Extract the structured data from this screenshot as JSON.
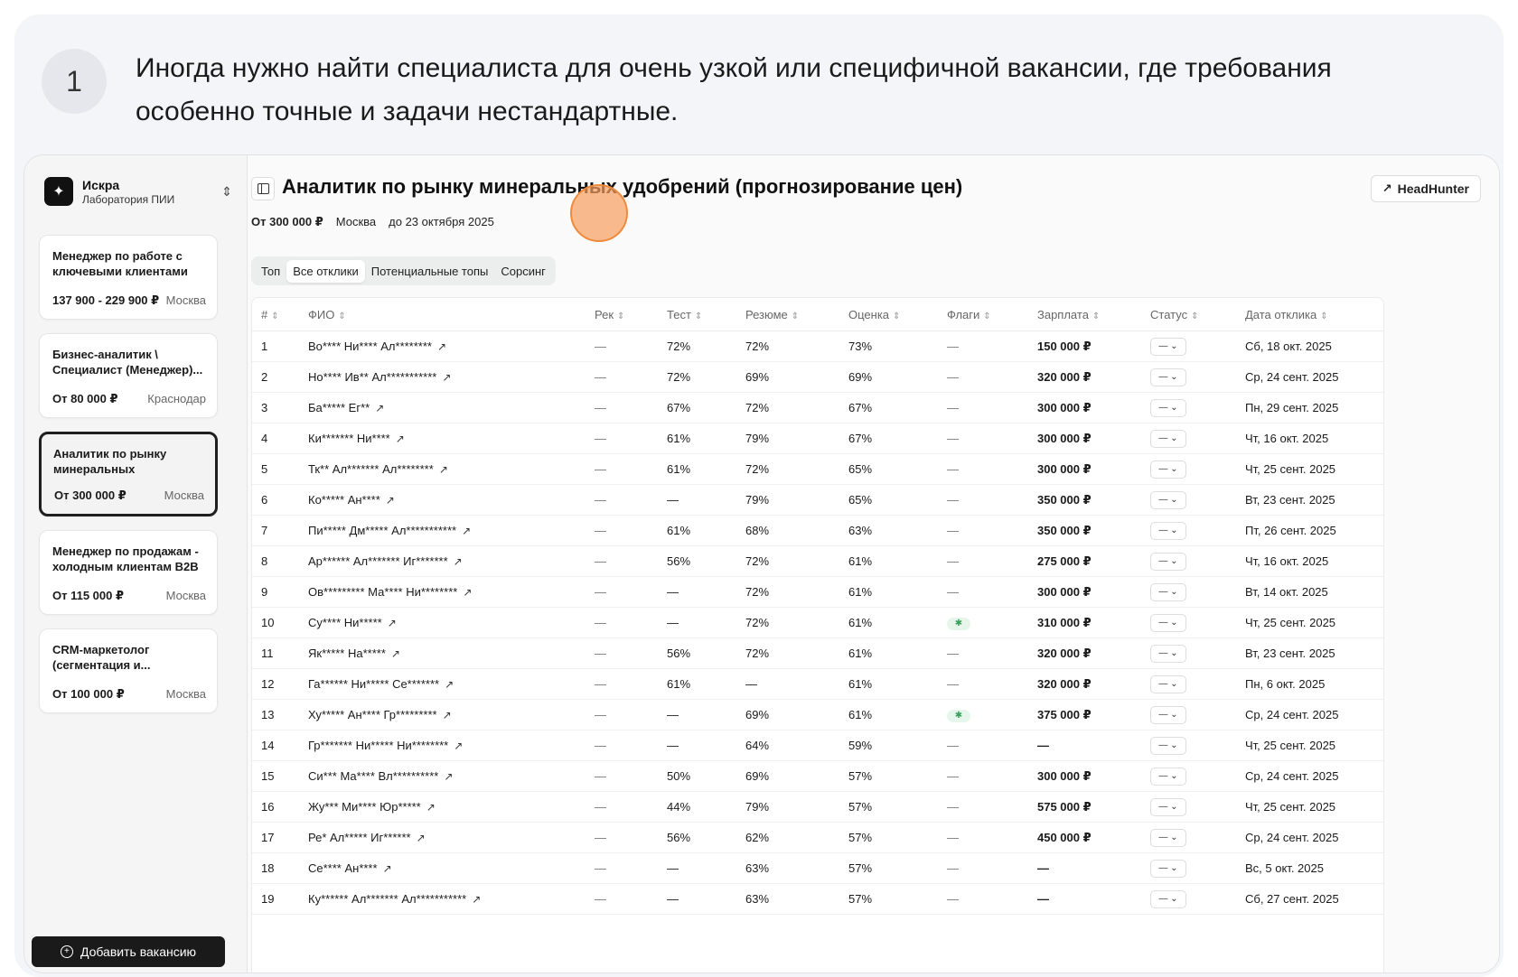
{
  "step": {
    "number": "1",
    "text": "Иногда нужно найти специалиста для очень узкой или специфичной вакансии, где требования особенно точные и задачи нестандартные."
  },
  "org": {
    "name": "Искра",
    "subtitle": "Лаборатория ПИИ"
  },
  "jobs": [
    {
      "title": "Менеджер по работе с ключевыми клиентами",
      "salary": "137 900 - 229 900 ₽",
      "city": "Москва"
    },
    {
      "title": "Бизнес-аналитик \\ Специалист (Менеджер)...",
      "salary": "От 80 000 ₽",
      "city": "Краснодар"
    },
    {
      "title": "Аналитик по рынку минеральных удобрени...",
      "salary": "От 300 000 ₽",
      "city": "Москва"
    },
    {
      "title": "Менеджер по продажам - холодным клиентам B2B",
      "salary": "От 115 000 ₽",
      "city": "Москва"
    },
    {
      "title": "CRM-маркетолог (сегментация и...",
      "salary": "От 100 000 ₽",
      "city": "Москва"
    }
  ],
  "add_button": "Добавить вакансию",
  "vacancy": {
    "title": "Аналитик по рынку минеральных удобрений (прогнозирование цен)",
    "salary": "От 300 000 ₽",
    "city": "Москва",
    "deadline": "до 23 октября 2025",
    "source_button": "HeadHunter"
  },
  "tabs": [
    "Топ",
    "Все отклики",
    "Потенциальные топы",
    "Сорсинг"
  ],
  "active_tab": 1,
  "columns": [
    "#",
    "ФИО",
    "Рек",
    "Тест",
    "Резюме",
    "Оценка",
    "Флаги",
    "Зарплата",
    "Статус",
    "Дата отклика"
  ],
  "status_label": "— ⌄",
  "rows": [
    {
      "n": "1",
      "name": "Во**** Ни**** Ал********",
      "rec": "—",
      "test": "72%",
      "resume": "72%",
      "score": "73%",
      "flag": "—",
      "salary": "150 000 ₽",
      "date": "Сб, 18 окт. 2025"
    },
    {
      "n": "2",
      "name": "Но**** Ив** Ал***********",
      "rec": "—",
      "test": "72%",
      "resume": "69%",
      "score": "69%",
      "flag": "—",
      "salary": "320 000 ₽",
      "date": "Ср, 24 сент. 2025"
    },
    {
      "n": "3",
      "name": "Ба***** Ег**",
      "rec": "—",
      "test": "67%",
      "resume": "72%",
      "score": "67%",
      "flag": "—",
      "salary": "300 000 ₽",
      "date": "Пн, 29 сент. 2025"
    },
    {
      "n": "4",
      "name": "Ки******* Ни****",
      "rec": "—",
      "test": "61%",
      "resume": "79%",
      "score": "67%",
      "flag": "—",
      "salary": "300 000 ₽",
      "date": "Чт, 16 окт. 2025"
    },
    {
      "n": "5",
      "name": "Тк** Ал******* Ал********",
      "rec": "—",
      "test": "61%",
      "resume": "72%",
      "score": "65%",
      "flag": "—",
      "salary": "300 000 ₽",
      "date": "Чт, 25 сент. 2025"
    },
    {
      "n": "6",
      "name": "Ко***** Ан****",
      "rec": "—",
      "test": "—",
      "resume": "79%",
      "score": "65%",
      "flag": "—",
      "salary": "350 000 ₽",
      "date": "Вт, 23 сент. 2025"
    },
    {
      "n": "7",
      "name": "Пи***** Дм***** Ал***********",
      "rec": "—",
      "test": "61%",
      "resume": "68%",
      "score": "63%",
      "flag": "—",
      "salary": "350 000 ₽",
      "date": "Пт, 26 сент. 2025"
    },
    {
      "n": "8",
      "name": "Ар****** Ал******* Иг*******",
      "rec": "—",
      "test": "56%",
      "resume": "72%",
      "score": "61%",
      "flag": "—",
      "salary": "275 000 ₽",
      "date": "Чт, 16 окт. 2025"
    },
    {
      "n": "9",
      "name": "Ов********* Ма**** Ни********",
      "rec": "—",
      "test": "—",
      "resume": "72%",
      "score": "61%",
      "flag": "—",
      "salary": "300 000 ₽",
      "date": "Вт, 14 окт. 2025"
    },
    {
      "n": "10",
      "name": "Су**** Ни*****",
      "rec": "—",
      "test": "—",
      "resume": "72%",
      "score": "61%",
      "flag": "✱",
      "salary": "310 000 ₽",
      "date": "Чт, 25 сент. 2025"
    },
    {
      "n": "11",
      "name": "Як***** На*****",
      "rec": "—",
      "test": "56%",
      "resume": "72%",
      "score": "61%",
      "flag": "—",
      "salary": "320 000 ₽",
      "date": "Вт, 23 сент. 2025"
    },
    {
      "n": "12",
      "name": "Га****** Ни***** Се*******",
      "rec": "—",
      "test": "61%",
      "resume": "—",
      "score": "61%",
      "flag": "—",
      "salary": "320 000 ₽",
      "date": "Пн, 6 окт. 2025"
    },
    {
      "n": "13",
      "name": "Ху***** Ан**** Гр*********",
      "rec": "—",
      "test": "—",
      "resume": "69%",
      "score": "61%",
      "flag": "✱",
      "salary": "375 000 ₽",
      "date": "Ср, 24 сент. 2025"
    },
    {
      "n": "14",
      "name": "Гр******* Ни***** Ни********",
      "rec": "—",
      "test": "—",
      "resume": "64%",
      "score": "59%",
      "flag": "—",
      "salary": "—",
      "date": "Чт, 25 сент. 2025"
    },
    {
      "n": "15",
      "name": "Си*** Ма**** Вл**********",
      "rec": "—",
      "test": "50%",
      "resume": "69%",
      "score": "57%",
      "flag": "—",
      "salary": "300 000 ₽",
      "date": "Ср, 24 сент. 2025"
    },
    {
      "n": "16",
      "name": "Жу*** Ми**** Юр*****",
      "rec": "—",
      "test": "44%",
      "resume": "79%",
      "score": "57%",
      "flag": "—",
      "salary": "575 000 ₽",
      "date": "Чт, 25 сент. 2025"
    },
    {
      "n": "17",
      "name": "Ре* Ал***** Иг******",
      "rec": "—",
      "test": "56%",
      "resume": "62%",
      "score": "57%",
      "flag": "—",
      "salary": "450 000 ₽",
      "date": "Ср, 24 сент. 2025"
    },
    {
      "n": "18",
      "name": "Се**** Ан****",
      "rec": "—",
      "test": "—",
      "resume": "63%",
      "score": "57%",
      "flag": "—",
      "salary": "—",
      "date": "Вс, 5 окт. 2025"
    },
    {
      "n": "19",
      "name": "Ку****** Ал******* Ал***********",
      "rec": "—",
      "test": "—",
      "resume": "63%",
      "score": "57%",
      "flag": "—",
      "salary": "—",
      "date": "Сб, 27 сент. 2025"
    }
  ],
  "colors": {
    "accent": "#1a1a1a",
    "cursor": "#ef8a3c",
    "flag_green": "#36a15a"
  }
}
